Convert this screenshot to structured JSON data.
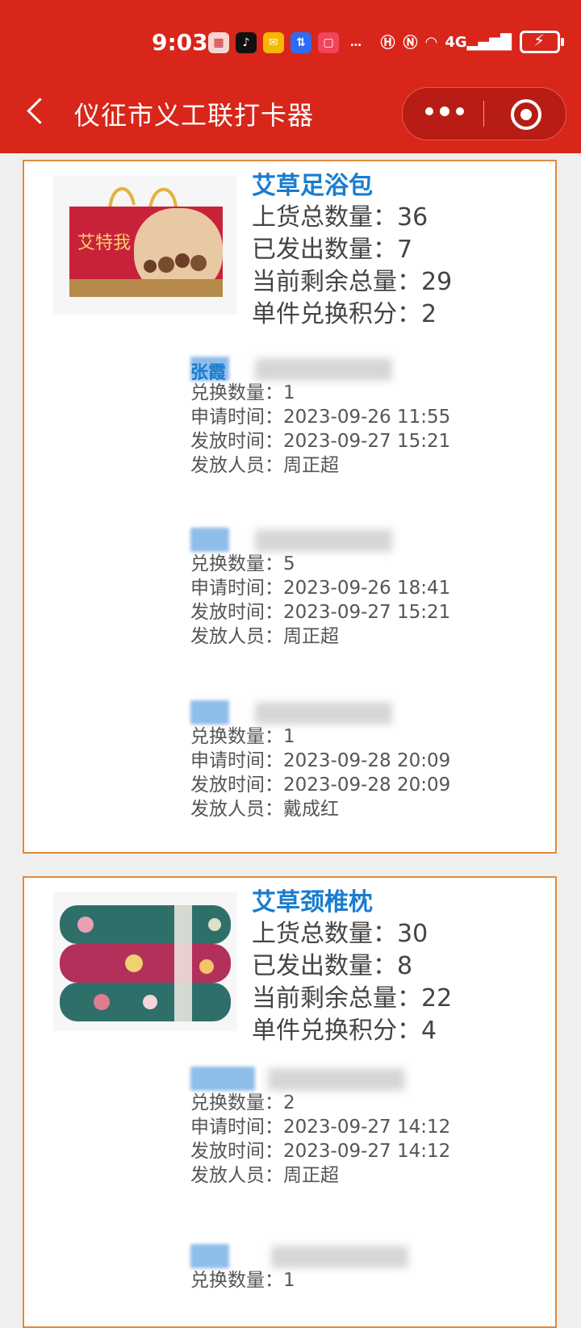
{
  "status_bar": {
    "time": "9:03",
    "net_label": "4G"
  },
  "header": {
    "title": "仪征市义工联打卡器"
  },
  "labels": {
    "total": "上货总数量：",
    "issued": "已发出数量：",
    "remaining": "当前剩余总量：",
    "points": "单件兑换积分：",
    "qty": "兑换数量：",
    "apply": "申请时间：",
    "issue": "发放时间：",
    "staff": "发放人员："
  },
  "products": [
    {
      "name": "艾草足浴包",
      "total": "36",
      "issued": "7",
      "remaining": "29",
      "points": "2",
      "records": [
        {
          "name": "张霞",
          "qty": "1",
          "apply_time": "2023-09-26 11:55",
          "issue_time": "2023-09-27 15:21",
          "staff": "周正超"
        },
        {
          "name": "",
          "qty": "5",
          "apply_time": "2023-09-26 18:41",
          "issue_time": "2023-09-27 15:21",
          "staff": "周正超"
        },
        {
          "name": "",
          "qty": "1",
          "apply_time": "2023-09-28 20:09",
          "issue_time": "2023-09-28 20:09",
          "staff": "戴成红"
        }
      ]
    },
    {
      "name": "艾草颈椎枕",
      "total": "30",
      "issued": "8",
      "remaining": "22",
      "points": "4",
      "records": [
        {
          "name": "",
          "qty": "2",
          "apply_time": "2023-09-27 14:12",
          "issue_time": "2023-09-27 14:12",
          "staff": "周正超"
        },
        {
          "name": "",
          "qty": "1"
        }
      ]
    }
  ]
}
